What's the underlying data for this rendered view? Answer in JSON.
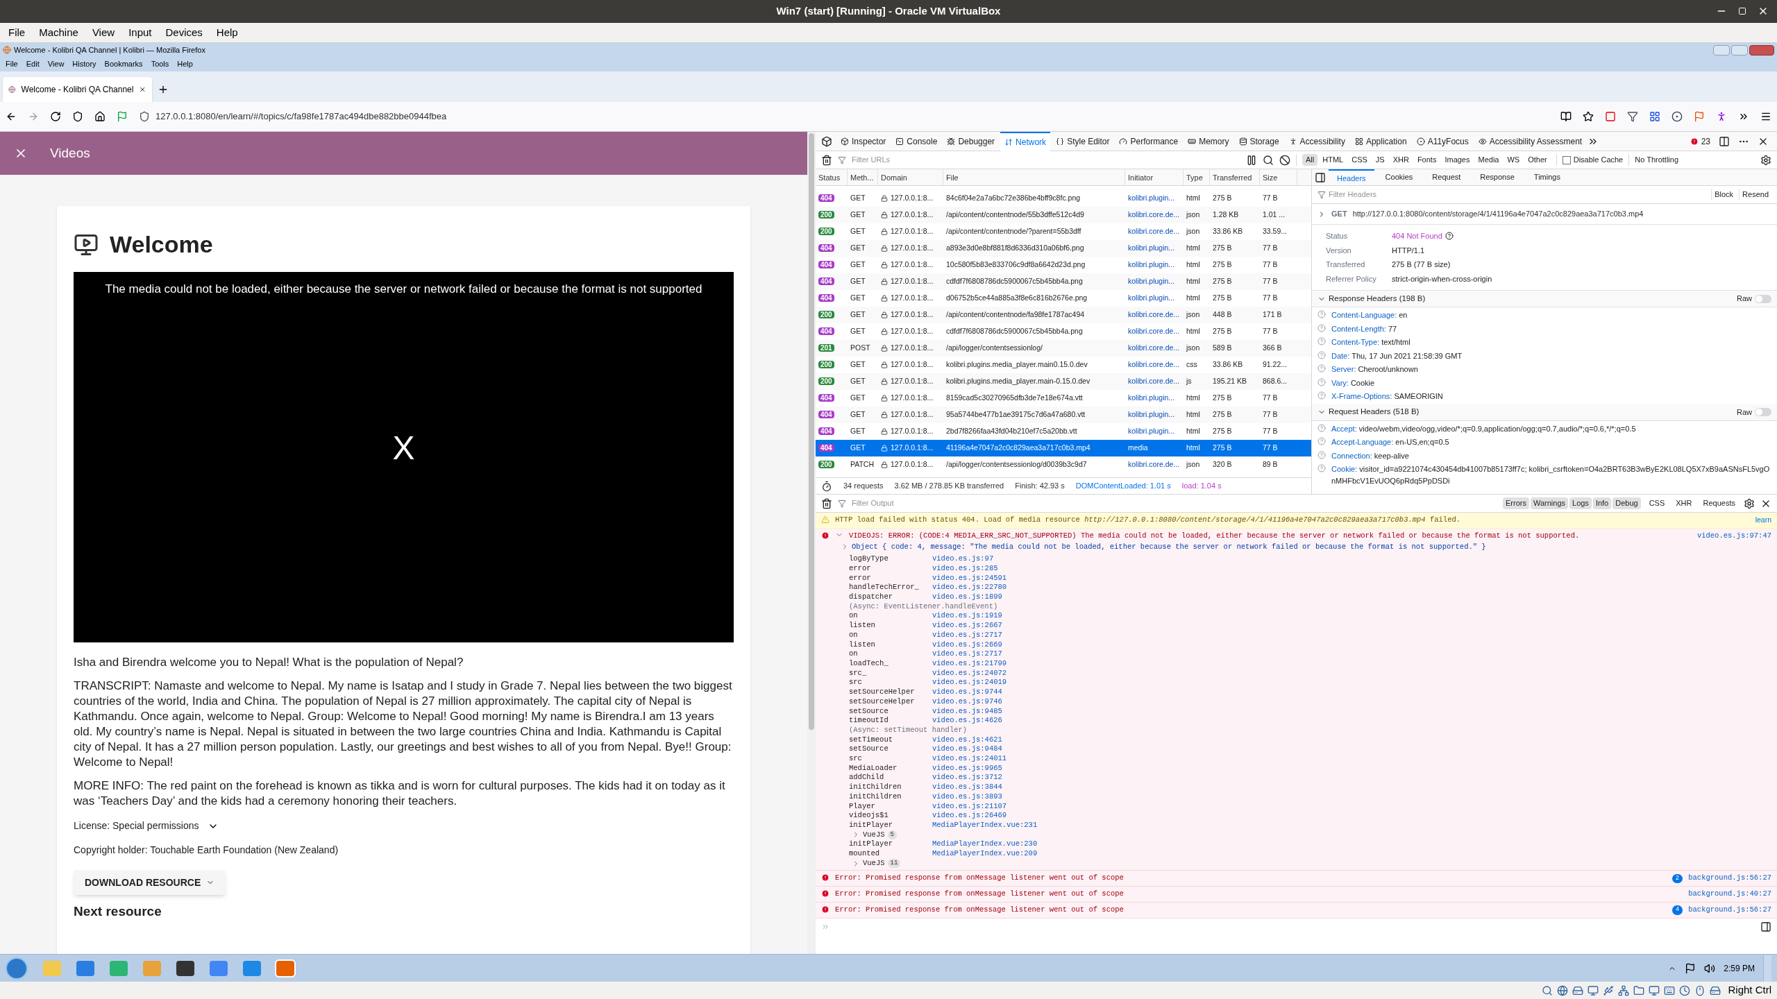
{
  "vm_window": {
    "title": "Win7 (start) [Running] - Oracle VM VirtualBox",
    "menu": [
      "File",
      "Machine",
      "View",
      "Input",
      "Devices",
      "Help"
    ]
  },
  "browser": {
    "window_title": "Welcome - Kolibri QA Channel | Kolibri — Mozilla Firefox",
    "menu": [
      "File",
      "Edit",
      "View",
      "History",
      "Bookmarks",
      "Tools",
      "Help"
    ],
    "tabs": [
      {
        "label": "Welcome - Kolibri QA Channel",
        "selected": true
      }
    ],
    "url": "127.0.0.1:8080/en/learn/#/topics/c/fa98fe1787ac494dbe882bbe0944fbea"
  },
  "page": {
    "header_title": "Videos",
    "title": "Welcome",
    "video_error": "The media could not be loaded, either because the server or network failed or because the format is not supported",
    "video_close": "X",
    "description": "Isha and Birendra welcome you to Nepal! What is the population of Nepal?",
    "transcript": "TRANSCRIPT: Namaste and welcome to Nepal. My name is Isatap and I study in Grade 7. Nepal lies between the two biggest countries of the world, India and China. The population of Nepal is 27 million approximately. The capital city of Nepal is Kathmandu. Once again, welcome to Nepal. Group: Welcome to Nepal! Good morning! My name is Birendra.I am 13 years old. My country’s name is Nepal. Nepal is situated in between the two large countries China and India. Kathmandu is Capital city of Nepal. It has a 27 million person population. Lastly, our greetings and best wishes to all of you from Nepal. Bye!! Group: Welcome to Nepal!",
    "more_info": "MORE INFO: The red paint on the forehead is known as tikka and is worn for cultural purposes. The kids had it on today as it was ‘Teachers Day’ and the kids had a ceremony honoring their teachers.",
    "license": "License: Special permissions",
    "copyright": "Copyright holder: Touchable Earth Foundation (New Zealand)",
    "download_button": "DOWNLOAD RESOURCE",
    "next_heading": "Next resource"
  },
  "devtools": {
    "tools": [
      {
        "label": "Inspector",
        "selected": false
      },
      {
        "label": "Console",
        "selected": false
      },
      {
        "label": "Debugger",
        "selected": false
      },
      {
        "label": "Network",
        "selected": true
      },
      {
        "label": "Style Editor",
        "selected": false
      },
      {
        "label": "Performance",
        "selected": false
      },
      {
        "label": "Memory",
        "selected": false
      },
      {
        "label": "Storage",
        "selected": false
      },
      {
        "label": "Accessibility",
        "selected": false
      },
      {
        "label": "Application",
        "selected": false
      },
      {
        "label": "A11yFocus",
        "selected": false
      },
      {
        "label": "Accessibility Assessment",
        "selected": false
      }
    ],
    "error_count": "23",
    "network": {
      "filter_placeholder": "Filter URLs",
      "type_filters": [
        {
          "label": "All",
          "selected": true
        },
        {
          "label": "HTML",
          "selected": false
        },
        {
          "label": "CSS",
          "selected": false
        },
        {
          "label": "JS",
          "selected": false
        },
        {
          "label": "XHR",
          "selected": false
        },
        {
          "label": "Fonts",
          "selected": false
        },
        {
          "label": "Images",
          "selected": false
        },
        {
          "label": "Media",
          "selected": false
        },
        {
          "label": "WS",
          "selected": false
        },
        {
          "label": "Other",
          "selected": false
        }
      ],
      "disable_cache": {
        "label": "Disable Cache",
        "checked": false
      },
      "throttling": "No Throttling",
      "columns": [
        "Status",
        "Meth...",
        "Domain",
        "File",
        "Initiator",
        "Type",
        "Transferred",
        "Size"
      ],
      "rows": [
        {
          "status": "404",
          "color": "#a83bc7",
          "method": "GET",
          "domain": "127.0.0.1:8...",
          "file": "84c6f04e2a7a6bc72e386be4bff9c8fc.png",
          "initiator": "kolibri.plugin...",
          "type": "html",
          "transferred": "275 B",
          "size": "77 B",
          "selected": false
        },
        {
          "status": "200",
          "color": "#2b8a3e",
          "method": "GET",
          "domain": "127.0.0.1:8...",
          "file": "/api/content/contentnode/55b3dffe512c4d9",
          "initiator": "kolibri.core.de...",
          "type": "json",
          "transferred": "1.28 KB",
          "size": "1.01 ...",
          "selected": false
        },
        {
          "status": "200",
          "color": "#2b8a3e",
          "method": "GET",
          "domain": "127.0.0.1:8...",
          "file": "/api/content/contentnode/?parent=55b3dff",
          "initiator": "kolibri.core.de...",
          "type": "json",
          "transferred": "33.86 KB",
          "size": "33.59...",
          "selected": false
        },
        {
          "status": "404",
          "color": "#a83bc7",
          "method": "GET",
          "domain": "127.0.0.1:8...",
          "file": "a893e3d0e8bf881f8d6336d310a06bf6.png",
          "initiator": "kolibri.plugin...",
          "type": "html",
          "transferred": "275 B",
          "size": "77 B",
          "selected": false
        },
        {
          "status": "404",
          "color": "#a83bc7",
          "method": "GET",
          "domain": "127.0.0.1:8...",
          "file": "10c580f5b83e833706c9df8a6642d23d.png",
          "initiator": "kolibri.plugin...",
          "type": "html",
          "transferred": "275 B",
          "size": "77 B",
          "selected": false
        },
        {
          "status": "404",
          "color": "#a83bc7",
          "method": "GET",
          "domain": "127.0.0.1:8...",
          "file": "cdfdf7f6808786dc5900067c5b45bb4a.png",
          "initiator": "kolibri.plugin...",
          "type": "html",
          "transferred": "275 B",
          "size": "77 B",
          "selected": false
        },
        {
          "status": "404",
          "color": "#a83bc7",
          "method": "GET",
          "domain": "127.0.0.1:8...",
          "file": "d06752b5ce44a885a3f8e6c816b2676e.png",
          "initiator": "kolibri.plugin...",
          "type": "html",
          "transferred": "275 B",
          "size": "77 B",
          "selected": false
        },
        {
          "status": "200",
          "color": "#2b8a3e",
          "method": "GET",
          "domain": "127.0.0.1:8...",
          "file": "/api/content/contentnode/fa98fe1787ac494",
          "initiator": "kolibri.core.de...",
          "type": "json",
          "transferred": "448 B",
          "size": "171 B",
          "selected": false
        },
        {
          "status": "404",
          "color": "#a83bc7",
          "method": "GET",
          "domain": "127.0.0.1:8...",
          "file": "cdfdf7f6808786dc5900067c5b45bb4a.png",
          "initiator": "kolibri.core.de...",
          "type": "html",
          "transferred": "275 B",
          "size": "77 B",
          "selected": false
        },
        {
          "status": "201",
          "color": "#2b8a3e",
          "method": "POST",
          "domain": "127.0.0.1:8...",
          "file": "/api/logger/contentsessionlog/",
          "initiator": "kolibri.core.de...",
          "type": "json",
          "transferred": "589 B",
          "size": "366 B",
          "selected": false
        },
        {
          "status": "200",
          "color": "#2b8a3e",
          "method": "GET",
          "domain": "127.0.0.1:8...",
          "file": "kolibri.plugins.media_player.main0.15.0.dev",
          "initiator": "kolibri.core.de...",
          "type": "css",
          "transferred": "33.86 KB",
          "size": "91.22...",
          "selected": false
        },
        {
          "status": "200",
          "color": "#2b8a3e",
          "method": "GET",
          "domain": "127.0.0.1:8...",
          "file": "kolibri.plugins.media_player.main-0.15.0.dev",
          "initiator": "kolibri.core.de...",
          "type": "js",
          "transferred": "195.21 KB",
          "size": "868.6...",
          "selected": false
        },
        {
          "status": "404",
          "color": "#a83bc7",
          "method": "GET",
          "domain": "127.0.0.1:8...",
          "file": "8159cad5c30270965dfb3de7e18e674a.vtt",
          "initiator": "kolibri.plugin...",
          "type": "html",
          "transferred": "275 B",
          "size": "77 B",
          "selected": false
        },
        {
          "status": "404",
          "color": "#a83bc7",
          "method": "GET",
          "domain": "127.0.0.1:8...",
          "file": "95a5744be477b1ae39175c7d6a47a680.vtt",
          "initiator": "kolibri.plugin...",
          "type": "html",
          "transferred": "275 B",
          "size": "77 B",
          "selected": false
        },
        {
          "status": "404",
          "color": "#a83bc7",
          "method": "GET",
          "domain": "127.0.0.1:8...",
          "file": "2bd7f8266faa43fd04b210ef7c5a20bb.vtt",
          "initiator": "kolibri.plugin...",
          "type": "html",
          "transferred": "275 B",
          "size": "77 B",
          "selected": false
        },
        {
          "status": "404",
          "color": "#a83bc7",
          "method": "GET",
          "domain": "127.0.0.1:8...",
          "file": "41196a4e7047a2c0c829aea3a717c0b3.mp4",
          "initiator": "media",
          "type": "html",
          "transferred": "275 B",
          "size": "77 B",
          "selected": true
        },
        {
          "status": "200",
          "color": "#2b8a3e",
          "method": "PATCH",
          "domain": "127.0.0.1:8...",
          "file": "/api/logger/contentsessionlog/d0039b3c9d7",
          "initiator": "kolibri.core.de...",
          "type": "json",
          "transferred": "320 B",
          "size": "89 B",
          "selected": false
        }
      ],
      "summary": {
        "requests": "34 requests",
        "size": "3.62 MB / 278.85 KB transferred",
        "finish": "Finish: 42.93 s",
        "dom_loaded": "DOMContentLoaded: 1.01 s",
        "load": "load: 1.04 s"
      }
    },
    "details": {
      "tabs": [
        {
          "label": "Headers",
          "selected": true
        },
        {
          "label": "Cookies",
          "selected": false
        },
        {
          "label": "Request",
          "selected": false
        },
        {
          "label": "Response",
          "selected": false
        },
        {
          "label": "Timings",
          "selected": false
        }
      ],
      "filter_placeholder": "Filter Headers",
      "block": "Block",
      "resend": "Resend",
      "request_line": {
        "method": "GET",
        "url": "http://127.0.0.1:8080/content/storage/4/1/41196a4e7047a2c0c829aea3a717c0b3.mp4"
      },
      "summary": [
        {
          "label": "Status",
          "value": "404 Not Found",
          "kind": "status"
        },
        {
          "label": "Version",
          "value": "HTTP/1.1",
          "kind": "plain"
        },
        {
          "label": "Transferred",
          "value": "275 B (77 B size)",
          "kind": "plain"
        },
        {
          "label": "Referrer Policy",
          "value": "strict-origin-when-cross-origin",
          "kind": "plain"
        }
      ],
      "sections": [
        {
          "title": "Response Headers (198 B)",
          "expanded": true,
          "raw": {
            "label": "Raw",
            "on": false
          },
          "headers": [
            {
              "name": "Content-Language:",
              "value": "en"
            },
            {
              "name": "Content-Length:",
              "value": "77"
            },
            {
              "name": "Content-Type:",
              "value": "text/html"
            },
            {
              "name": "Date:",
              "value": "Thu, 17 Jun 2021 21:58:39 GMT"
            },
            {
              "name": "Server:",
              "value": "Cheroot/unknown"
            },
            {
              "name": "Vary:",
              "value": "Cookie"
            },
            {
              "name": "X-Frame-Options:",
              "value": "SAMEORIGIN"
            }
          ]
        },
        {
          "title": "Request Headers (518 B)",
          "expanded": true,
          "raw": {
            "label": "Raw",
            "on": false
          },
          "headers": [
            {
              "name": "Accept:",
              "value": "video/webm,video/ogg,video/*;q=0.9,application/ogg;q=0.7,audio/*;q=0.6,*/*;q=0.5"
            },
            {
              "name": "Accept-Language:",
              "value": "en-US,en;q=0.5"
            },
            {
              "name": "Connection:",
              "value": "keep-alive"
            },
            {
              "name": "Cookie:",
              "value": "visitor_id=a9221074c430454db41007b85173ff7c; kolibri_csrftoken=O4a2BRT63B3wByE2KL08LQ5X7xB9aASNsFL5vgOnMHFbcV1EvUOQ6pRdq5PpDSDi"
            }
          ]
        }
      ]
    },
    "console": {
      "filter_placeholder": "Filter Output",
      "levels": [
        {
          "label": "Errors",
          "selected": true
        },
        {
          "label": "Warnings",
          "selected": true
        },
        {
          "label": "Logs",
          "selected": true
        },
        {
          "label": "Info",
          "selected": true
        },
        {
          "label": "Debug",
          "selected": true
        }
      ],
      "extra_filters": [
        "CSS",
        "XHR",
        "Requests"
      ],
      "messages": [
        {
          "kind": "warning",
          "text": "HTTP load failed with status 404. Load of media resource *http://127.0.0.1:8080/content/storage/4/1/41196a4e7047a2c0c829aea3a717c0b3.mp4* failed.",
          "location": "learn"
        },
        {
          "kind": "error",
          "text": "VIDEOJS: ERROR: (CODE:4 MEDIA_ERR_SRC_NOT_SUPPORTED) The media could not be loaded, either because the server or network failed or because the format is not supported.",
          "location": "video.es.js:97:47",
          "object": "Object { code: 4, message: \"The media could not be loaded, either because the server or network failed or because the format is not supported.\" }",
          "stack": [
            {
              "kind": "frame",
              "fn": "logByType",
              "loc": "video.es.js:97"
            },
            {
              "kind": "frame",
              "fn": "error",
              "loc": "video.es.js:285"
            },
            {
              "kind": "frame",
              "fn": "error",
              "loc": "video.es.js:24591"
            },
            {
              "kind": "frame",
              "fn": "handleTechError_",
              "loc": "video.es.js:22780"
            },
            {
              "kind": "frame",
              "fn": "dispatcher",
              "loc": "video.es.js:1899"
            },
            {
              "kind": "async",
              "text": "(Async: EventListener.handleEvent)"
            },
            {
              "kind": "frame",
              "fn": "on",
              "loc": "video.es.js:1919"
            },
            {
              "kind": "frame",
              "fn": "listen",
              "loc": "video.es.js:2667"
            },
            {
              "kind": "frame",
              "fn": "on",
              "loc": "video.es.js:2717"
            },
            {
              "kind": "frame",
              "fn": "listen",
              "loc": "video.es.js:2669"
            },
            {
              "kind": "frame",
              "fn": "on",
              "loc": "video.es.js:2717"
            },
            {
              "kind": "frame",
              "fn": "loadTech_",
              "loc": "video.es.js:21799"
            },
            {
              "kind": "frame",
              "fn": "src_",
              "loc": "video.es.js:24072"
            },
            {
              "kind": "frame",
              "fn": "src",
              "loc": "video.es.js:24019"
            },
            {
              "kind": "frame",
              "fn": "setSourceHelper",
              "loc": "video.es.js:9744"
            },
            {
              "kind": "frame",
              "fn": "setSourceHelper",
              "loc": "video.es.js:9746"
            },
            {
              "kind": "frame",
              "fn": "setSource",
              "loc": "video.es.js:9485"
            },
            {
              "kind": "frame",
              "fn": "timeoutId",
              "loc": "video.es.js:4626"
            },
            {
              "kind": "async",
              "text": "(Async: setTimeout handler)"
            },
            {
              "kind": "frame",
              "fn": "setTimeout",
              "loc": "video.es.js:4621"
            },
            {
              "kind": "frame",
              "fn": "setSource",
              "loc": "video.es.js:9484"
            },
            {
              "kind": "frame",
              "fn": "src",
              "loc": "video.es.js:24011"
            },
            {
              "kind": "frame",
              "fn": "MediaLoader",
              "loc": "video.es.js:9965"
            },
            {
              "kind": "frame",
              "fn": "addChild",
              "loc": "video.es.js:3712"
            },
            {
              "kind": "frame",
              "fn": "initChildren",
              "loc": "video.es.js:3844"
            },
            {
              "kind": "frame",
              "fn": "initChildren",
              "loc": "video.es.js:3893"
            },
            {
              "kind": "frame",
              "fn": "Player",
              "loc": "video.es.js:21107"
            },
            {
              "kind": "frame",
              "fn": "videojs$1",
              "loc": "video.es.js:26469"
            },
            {
              "kind": "frame",
              "fn": "initPlayer",
              "loc": "MediaPlayerIndex.vue:231"
            },
            {
              "kind": "group",
              "label": "VueJS",
              "count": "5"
            },
            {
              "kind": "frame",
              "fn": "initPlayer",
              "loc": "MediaPlayerIndex.vue:230"
            },
            {
              "kind": "frame",
              "fn": "mounted",
              "loc": "MediaPlayerIndex.vue:209"
            },
            {
              "kind": "group",
              "label": "VueJS",
              "count": "11"
            }
          ]
        },
        {
          "kind": "error",
          "text": "Error: Promised response from onMessage listener went out of scope",
          "repeat": "2",
          "location": "background.js:56:27"
        },
        {
          "kind": "error",
          "text": "Error: Promised response from onMessage listener went out of scope",
          "location": "background.js:40:27"
        },
        {
          "kind": "error",
          "text": "Error: Promised response from onMessage listener went out of scope",
          "repeat": "4",
          "location": "background.js:56:27"
        }
      ]
    }
  },
  "taskbar": {
    "time": "2:59 PM"
  },
  "vm_status": {
    "host_key": "Right Ctrl"
  }
}
